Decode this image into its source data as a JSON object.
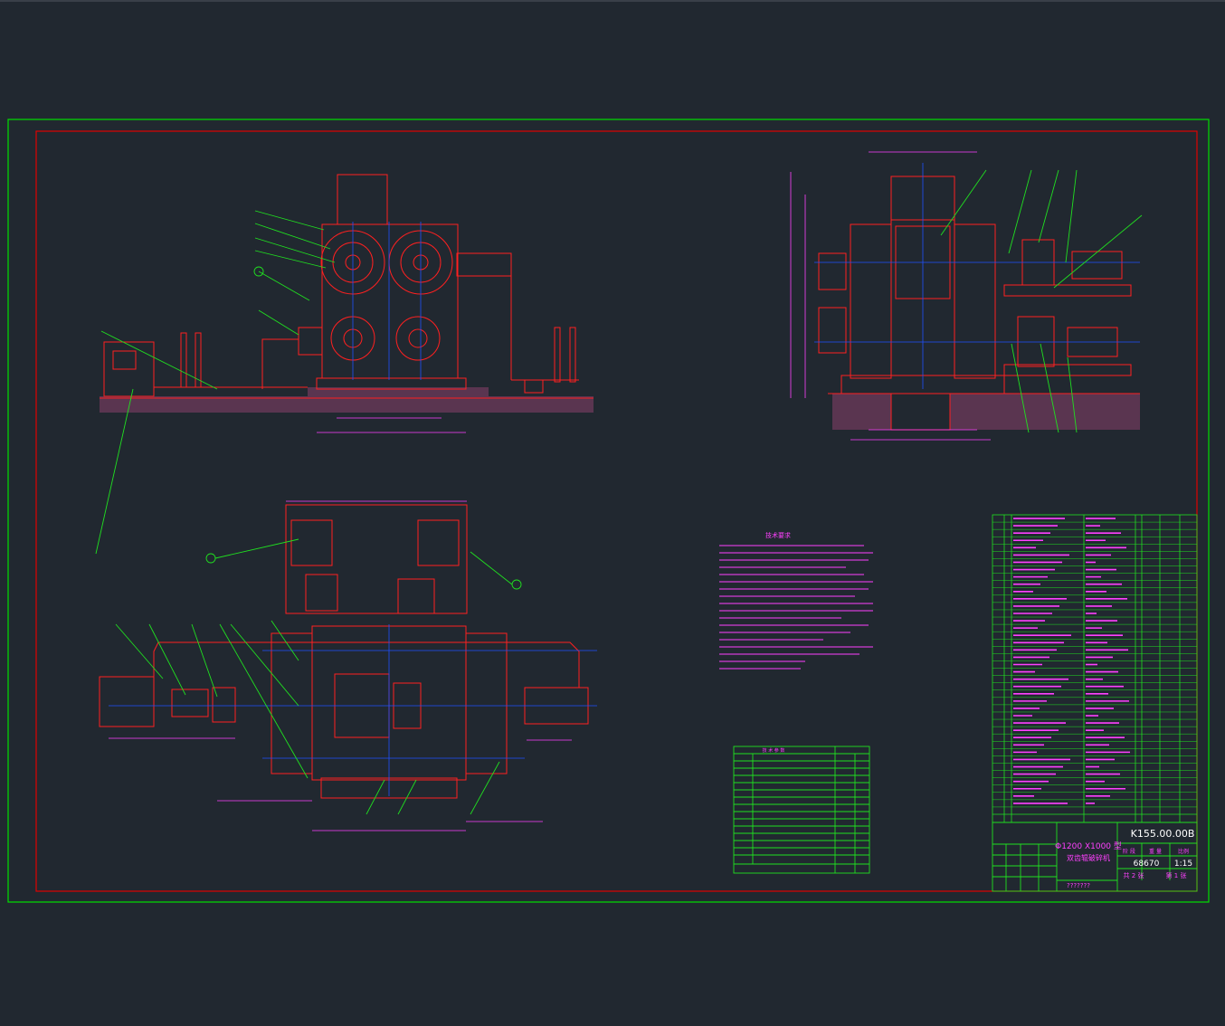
{
  "title_block": {
    "drawing_number": "K155.00.00B",
    "title_line1": "Φ1200 X1000 型",
    "title_line2": "双齿辊破碎机",
    "mass": "68670",
    "scale": "1:15",
    "sheets_total": "共 2 张",
    "sheet_no": "第 1 张",
    "label_weight": "重 量",
    "label_scale": "比例",
    "label_stage": "阶 段",
    "footer": "???????"
  },
  "notes_heading": "技术要求",
  "spec_table_heading": "技 术 参 数",
  "colors": {
    "background": "#212830",
    "outer_frame": "#00e000",
    "inner_frame": "#e00000",
    "geometry": "#ff2020",
    "dimension": "#ff40ff",
    "centerline": "#2050ff",
    "leader": "#20e020",
    "table": "#20e020",
    "text": "#ffffff"
  }
}
